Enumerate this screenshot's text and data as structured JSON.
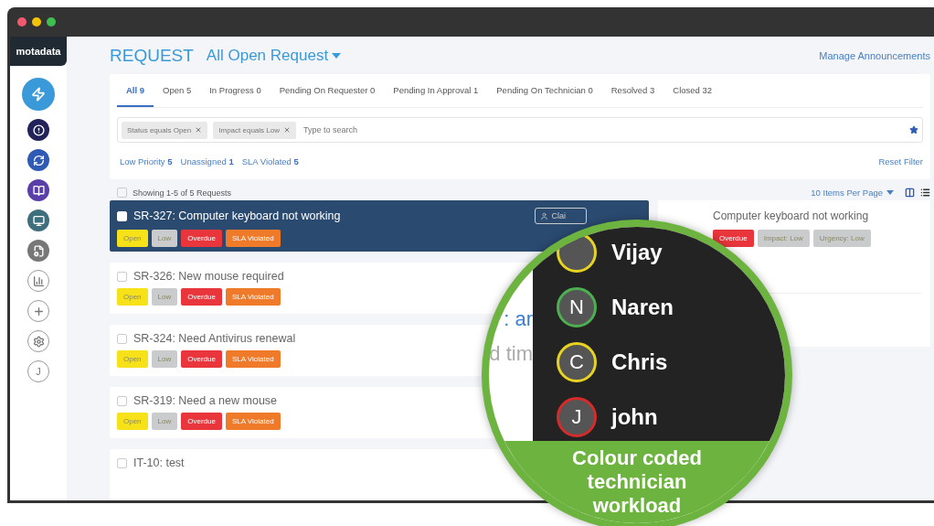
{
  "sidebar": {
    "logo": "motadata",
    "items": [
      {
        "selected": true
      },
      {
        "selected": false
      },
      {
        "selected": false
      },
      {
        "selected": false
      },
      {
        "selected": false
      },
      {
        "selected": false
      },
      {
        "selected": false
      },
      {
        "selected": false
      },
      {
        "selected": false
      },
      {
        "selected": false,
        "label": "J"
      }
    ]
  },
  "header": {
    "title": "REQUEST",
    "view": "All Open Request",
    "link": "Manage Announcements"
  },
  "tabs": [
    {
      "label": "All 9",
      "selected": true
    },
    {
      "label": "Open 5",
      "selected": false
    },
    {
      "label": "In Progress 0",
      "selected": false
    },
    {
      "label": "Pending On Requester 0",
      "selected": false
    },
    {
      "label": "Pending In Approval 1",
      "selected": false
    },
    {
      "label": "Pending On Technician 0",
      "selected": false
    },
    {
      "label": "Resolved 3",
      "selected": false
    },
    {
      "label": "Closed 32",
      "selected": false
    }
  ],
  "search": {
    "chips": [
      "Status equals Open",
      "Impact equals Low"
    ],
    "placeholder": "Type to search"
  },
  "quick_filters": [
    "Low Priority **5**",
    "Unassigned **1**",
    "SLA Violated **5**"
  ],
  "reset_filter": "Reset Filter",
  "list_header": {
    "checked": false,
    "summary": "Showing 1-5 of 5 Requests",
    "per_page": "10 Items Per Page"
  },
  "requests": [
    {
      "title": "SR-327: Computer keyboard not working",
      "selected": true,
      "checked": false,
      "claim": "Clai",
      "tags": [
        {
          "label": "Open",
          "color": "#f7e21a"
        },
        {
          "label": "Low",
          "color": "#c9cbcd"
        },
        {
          "label": "Overdue",
          "color": "#e8363c"
        },
        {
          "label": "SLA Violated",
          "color": "#ef7a2a"
        }
      ]
    },
    {
      "title": "SR-326: New mouse required",
      "selected": false,
      "checked": false,
      "tags": [
        {
          "label": "Open",
          "color": "#f7e21a"
        },
        {
          "label": "Low",
          "color": "#c9cbcd"
        },
        {
          "label": "Overdue",
          "color": "#e8363c"
        },
        {
          "label": "SLA Violated",
          "color": "#ef7a2a"
        }
      ]
    },
    {
      "title": "SR-324: Need Antivirus renewal",
      "selected": false,
      "checked": false,
      "tags": [
        {
          "label": "Open",
          "color": "#f7e21a"
        },
        {
          "label": "Low",
          "color": "#c9cbcd"
        },
        {
          "label": "Overdue",
          "color": "#e8363c"
        },
        {
          "label": "SLA Violated",
          "color": "#ef7a2a"
        }
      ]
    },
    {
      "title": "SR-319: Need a new mouse",
      "selected": false,
      "checked": false,
      "tags": [
        {
          "label": "Open",
          "color": "#f7e21a"
        },
        {
          "label": "Low",
          "color": "#c9cbcd"
        },
        {
          "label": "Overdue",
          "color": "#e8363c"
        },
        {
          "label": "SLA Violated",
          "color": "#ef7a2a"
        }
      ]
    },
    {
      "title": "IT-10: test",
      "selected": false,
      "checked": false
    }
  ],
  "detail": {
    "title": "Computer keyboard not working",
    "tags": [
      {
        "label": "Overdue",
        "color": "#e8363c"
      },
      {
        "label": "Impact: Low",
        "color": "#c9cbcd"
      },
      {
        "label": "Urgency: Low",
        "color": "#c9cbcd"
      }
    ]
  },
  "magnifier": {
    "fragments": [
      ": ar",
      "d tim"
    ],
    "technicians": [
      {
        "name": "Vijay",
        "color": "#e8d320"
      },
      {
        "initial": "N",
        "name": "Naren",
        "color": "#4caf50"
      },
      {
        "initial": "C",
        "name": "Chris",
        "color": "#e8d320"
      },
      {
        "initial": "J",
        "name": "john",
        "color": "#d62b2b"
      }
    ],
    "caption": "Colour coded technician workload"
  }
}
